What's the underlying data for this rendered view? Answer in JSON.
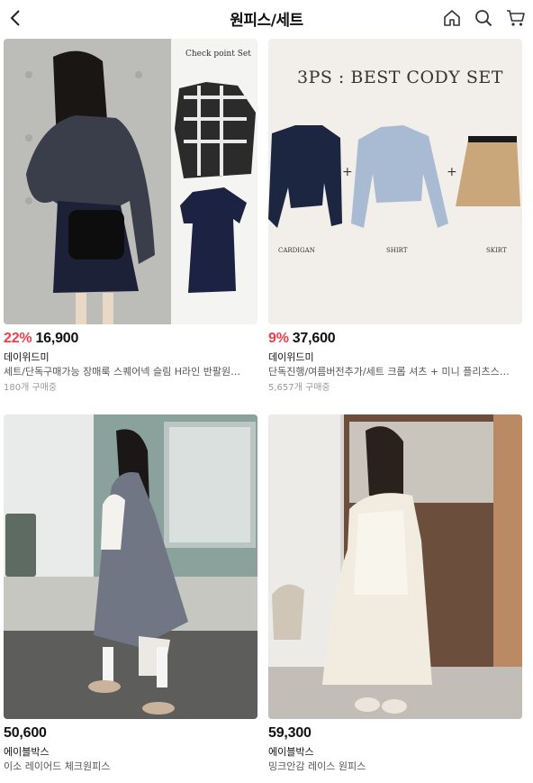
{
  "header": {
    "title": "원피스/세트",
    "back_icon": "chevron-left-icon",
    "home_icon": "home-icon",
    "search_icon": "search-icon",
    "cart_icon": "cart-icon"
  },
  "products": [
    {
      "discount": "22%",
      "price": "16,900",
      "brand": "데이위드미",
      "name": "세트/단독구매가능 장매룩 스퀘어넥 슬림 H라인 반팔원피스…",
      "sold": "180개 구매중",
      "image_text": "Check point Set"
    },
    {
      "discount": "9%",
      "price": "37,600",
      "brand": "데이위드미",
      "name": "단독진행/여름버전추가/세트 크롭 셔츠 + 미니 플리츠스커…",
      "sold": "5,657개 구매중",
      "image_text": "3PS : BEST CODY SET",
      "image_labels": [
        "CARDIGAN",
        "SHIRT",
        "SKIRT"
      ],
      "image_plus": "+"
    },
    {
      "price": "50,600",
      "brand": "에이블박스",
      "name": "이소 레이어드 체크원피스"
    },
    {
      "price": "59,300",
      "brand": "에이블박스",
      "name": "밍크안감 레이스 원피스"
    }
  ],
  "colors": {
    "discount": "#ef3e4a",
    "text": "#111111",
    "subtext": "#555555",
    "muted": "#999999"
  }
}
